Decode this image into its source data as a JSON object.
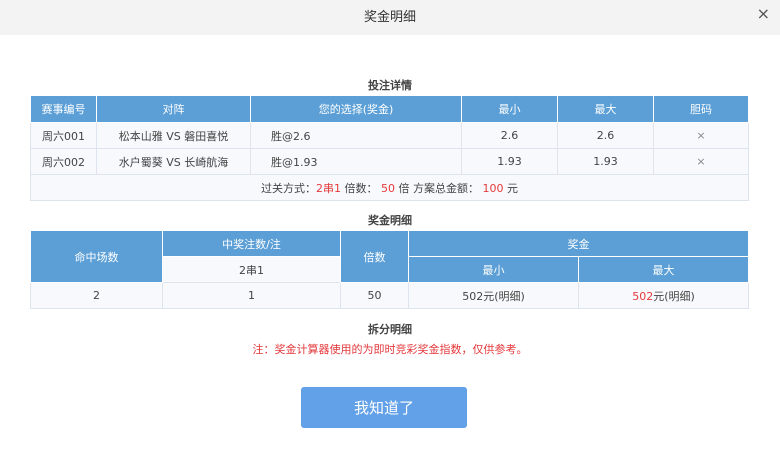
{
  "title": "奖金明细",
  "close_icon": "×",
  "bet_section": {
    "title": "投注详情",
    "headers": [
      "赛事编号",
      "对阵",
      "您的选择(奖金)",
      "最小",
      "最大",
      "胆码"
    ],
    "rows": [
      [
        "周六001",
        "松本山雅 VS 磐田喜悦",
        "胜@2.6",
        "2.6",
        "2.6",
        "×"
      ],
      [
        "周六002",
        "水户蜀葵 VS 长崎航海",
        "胜@1.93",
        "1.93",
        "1.93",
        "×"
      ]
    ],
    "summary": {
      "pass_label": "过关方式：",
      "pass_value": "2串1",
      "mult_label": " 倍数：",
      "mult_value": "50",
      "mult_unit": " 倍 方案总金额：",
      "amount_value": "100",
      "amount_unit": " 元"
    }
  },
  "prize_section": {
    "title": "奖金明细",
    "headers": {
      "hits": "命中场数",
      "win_bets": "中奖注数/注",
      "win_sub": "2串1",
      "multiple": "倍数",
      "prize": "奖金",
      "min": "最小",
      "max": "最大"
    },
    "row": {
      "hits": "2",
      "win_bets": "1",
      "multiple": "50",
      "min": "502元(明细)",
      "max_num": "502",
      "max_rest": "元(明细)"
    }
  },
  "split_title": "拆分明细",
  "note": "注：奖金计算器使用的为即时竞彩奖金指数，仅供参考。",
  "confirm_button": "我知道了"
}
